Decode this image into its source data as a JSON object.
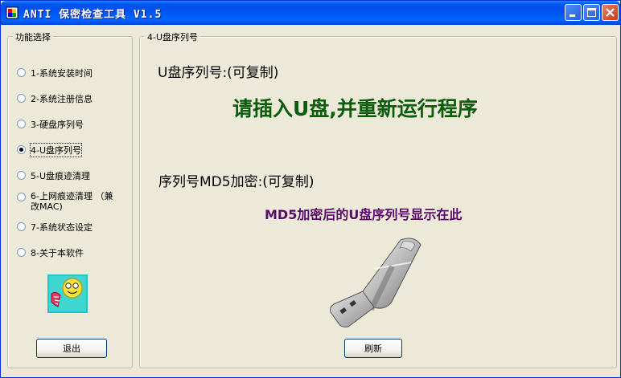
{
  "window": {
    "title": "ANTI 保密检查工具 V1.5"
  },
  "left_panel": {
    "title": "功能选择",
    "options": [
      {
        "label": "1-系统安装时间",
        "selected": false
      },
      {
        "label": "2-系统注册信息",
        "selected": false
      },
      {
        "label": "3-硬盘序列号",
        "selected": false
      },
      {
        "label": "4-U盘序列号",
        "selected": true
      },
      {
        "label": "5-U盘痕迹清理",
        "selected": false
      },
      {
        "label": "6-上网痕迹清理  （兼改MAC)",
        "selected": false
      },
      {
        "label": "7-系统状态设定",
        "selected": false
      },
      {
        "label": "8-关于本软件",
        "selected": false
      }
    ],
    "exit_button": "退出"
  },
  "right_panel": {
    "title": "4-U盘序列号",
    "serial_label": "U盘序列号:(可复制)",
    "serial_message": "请插入U盘,并重新运行程序",
    "md5_label": "序列号MD5加密:(可复制)",
    "md5_message": "MD5加密后的U盘序列号显示在此",
    "refresh_button": "刷新"
  },
  "colors": {
    "titlebar": "#0054E3",
    "serial_message": "#0A5B0A",
    "md5_message": "#5A0A6B",
    "window_bg": "#ECE9D8"
  },
  "icons": [
    "app-icon",
    "minimize-icon",
    "maximize-icon",
    "close-icon",
    "smiley-logo-icon",
    "usb-drive-image"
  ]
}
